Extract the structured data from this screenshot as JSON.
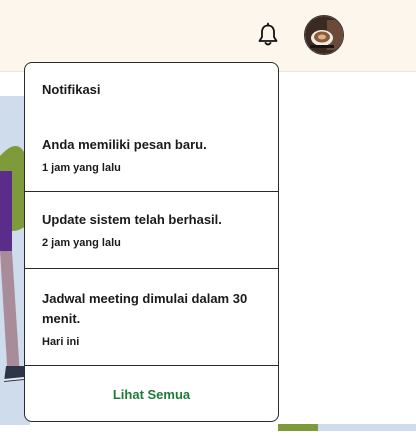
{
  "header": {
    "bell_icon": "bell-icon",
    "avatar_icon": "user-avatar-coffee"
  },
  "notifications": {
    "title": "Notifikasi",
    "items": [
      {
        "message": "Anda memiliki pesan baru.",
        "time": "1 jam yang lalu"
      },
      {
        "message": "Update sistem telah berhasil.",
        "time": "2 jam yang lalu"
      },
      {
        "message": "Jadwal meeting dimulai dalam 30 menit.",
        "time": "Hari ini"
      }
    ],
    "view_all_label": "Lihat Semua"
  },
  "colors": {
    "header_bg": "#fdf6ec",
    "link_green": "#1f7a3a",
    "border": "#2a2a2a"
  }
}
